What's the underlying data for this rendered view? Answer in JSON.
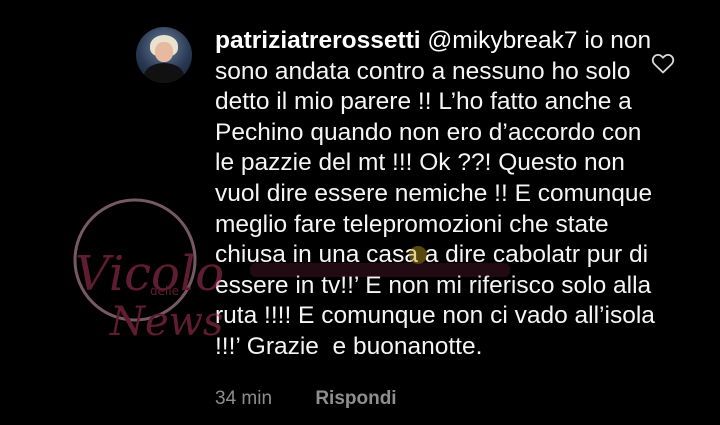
{
  "comment": {
    "username": "patriziatrerossetti",
    "mention": "@mikybreak7",
    "text": " io non sono andata contro a nessuno ho solo detto il mio parere !! L’ho fatto anche a Pechino quando non ero d’accordo con le pazzie del mt !!! Ok ??! Questo non vuol dire essere nemiche !! E comunque meglio fare telepromozioni che state chiusa in una casa a dire cabolatr pur di essere in tv!!’ E non mi riferisco solo alla ruta !!!! E comunque non ci vado all’isola !!!’ Grazie  e buonanotte.",
    "time": "34 min",
    "reply_label": "Rispondi",
    "like_icon": "heart-outline-icon"
  },
  "watermark": {
    "line1": "Vicolo",
    "line2": "delle",
    "line3": "News"
  },
  "colors": {
    "background": "#000000",
    "text": "#f5f5f5",
    "meta": "#8e8e8e",
    "watermark": "#b0365a"
  }
}
